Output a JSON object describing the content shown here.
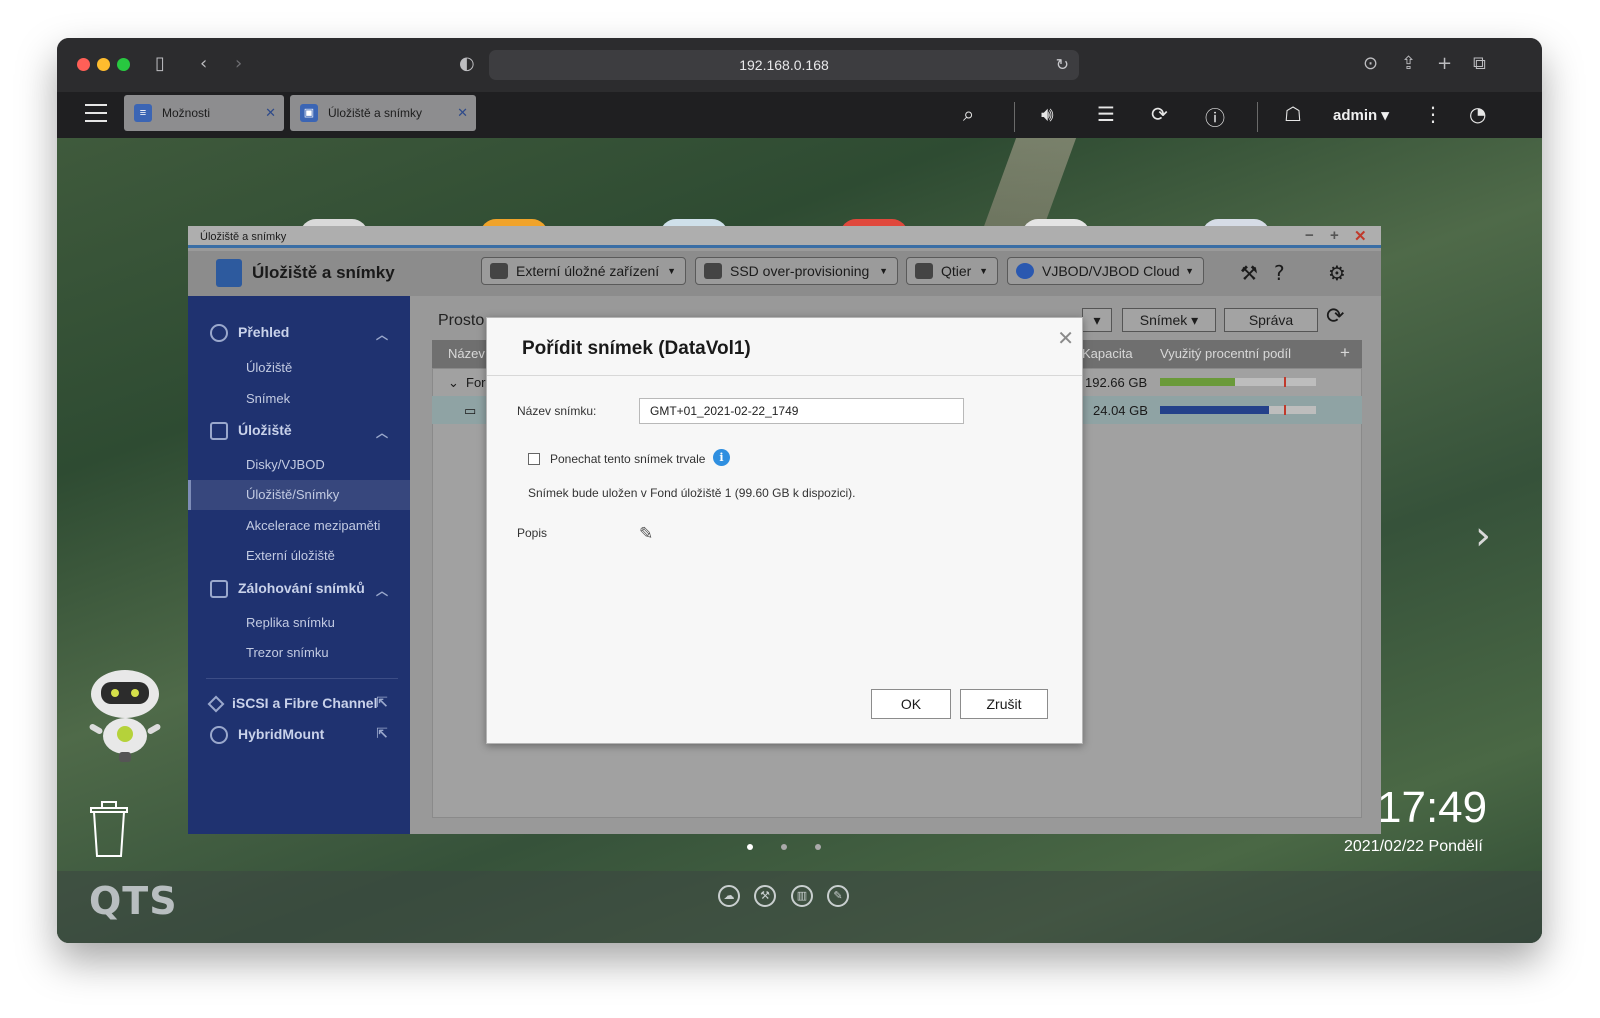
{
  "browser": {
    "url": "192.168.0.168"
  },
  "qts_bar": {
    "tabs": [
      {
        "label": "Možnosti",
        "icon": "options-icon"
      },
      {
        "label": "Úložiště a snímky",
        "icon": "storage-icon"
      }
    ],
    "user": "admin"
  },
  "app": {
    "window_title": "Úložiště a snímky",
    "title": "Úložiště a snímky",
    "header_buttons": [
      {
        "label": "Externí úložné zařízení"
      },
      {
        "label": "SSD over-provisioning"
      },
      {
        "label": "Qtier"
      },
      {
        "label": "VJBOD/VJBOD Cloud"
      }
    ]
  },
  "sidebar": {
    "sections": [
      {
        "label": "Přehled",
        "items": [
          "Úložiště",
          "Snímek"
        ]
      },
      {
        "label": "Úložiště",
        "items": [
          "Disky/VJBOD",
          "Úložiště/Snímky",
          "Akcelerace mezipaměti",
          "Externí úložiště"
        ]
      },
      {
        "label": "Zálohování snímků",
        "items": [
          "Replika snímku",
          "Trezor snímku"
        ]
      }
    ],
    "links": [
      "iSCSI a Fibre Channel",
      "HybridMount"
    ]
  },
  "content": {
    "title": "Prosto",
    "toolbar": {
      "snapshot": "Snímek",
      "manage": "Správa"
    },
    "columns": {
      "name": "Název",
      "capacity": "Kapacita",
      "usage": "Využitý procentní podíl"
    },
    "rows": [
      {
        "name": "For",
        "capacity": "192.66 GB",
        "usage_fraction": 0.48,
        "color": "#6a9a3a"
      },
      {
        "name": "",
        "capacity": "24.04 GB",
        "usage_fraction": 0.7,
        "color": "#24418a"
      }
    ]
  },
  "modal": {
    "title": "Pořídit snímek (DataVol1)",
    "name_label": "Název snímku:",
    "name_value": "GMT+01_2021-02-22_1749",
    "keep_label": "Ponechat tento snímek trvale",
    "info_text": "Snímek bude uložen v Fond úložiště 1 (99.60 GB k dispozici).",
    "desc_label": "Popis",
    "ok": "OK",
    "cancel": "Zrušit"
  },
  "desktop": {
    "time": "17:49",
    "date": "2021/02/22 Pondělí",
    "logo": "QTS"
  }
}
